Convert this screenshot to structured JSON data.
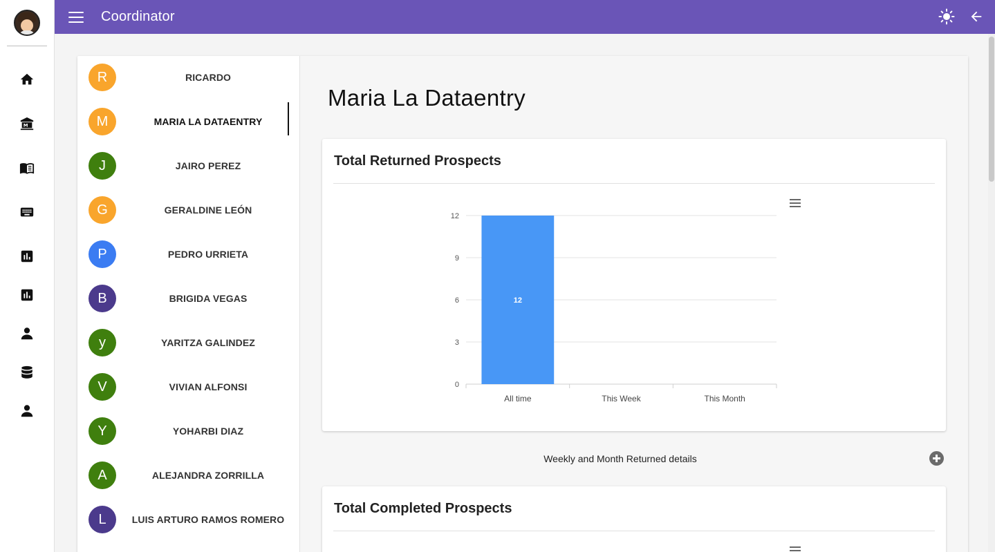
{
  "app": {
    "title": "Coordinator"
  },
  "topbar": {
    "menu_icon": "menu-icon",
    "theme_icon": "brightness-icon",
    "back_icon": "arrow-back-icon"
  },
  "rail": {
    "avatar": "user-avatar",
    "items": [
      {
        "name": "home-icon"
      },
      {
        "name": "institution-icon"
      },
      {
        "name": "book-icon"
      },
      {
        "name": "keyboard-icon"
      },
      {
        "name": "bar-chart-icon"
      },
      {
        "name": "bar-chart-icon"
      },
      {
        "name": "person-icon"
      },
      {
        "name": "database-icon"
      },
      {
        "name": "person-icon"
      }
    ]
  },
  "people": [
    {
      "initial": "R",
      "name": "RICARDO",
      "color": "#f9a52c"
    },
    {
      "initial": "M",
      "name": "MARIA LA DATAENTRY",
      "color": "#f9a52c",
      "active": true
    },
    {
      "initial": "J",
      "name": "JAIRO PEREZ",
      "color": "#3f7f0e"
    },
    {
      "initial": "G",
      "name": "GERALDINE LEÓN",
      "color": "#f9a52c"
    },
    {
      "initial": "P",
      "name": "PEDRO URRIETA",
      "color": "#3b7cf2"
    },
    {
      "initial": "B",
      "name": "BRIGIDA VEGAS",
      "color": "#4b3a8c"
    },
    {
      "initial": "y",
      "name": "YARITZA GALINDEZ",
      "color": "#3f7f0e"
    },
    {
      "initial": "V",
      "name": "VIVIAN ALFONSI",
      "color": "#3f7f0e"
    },
    {
      "initial": "Y",
      "name": "YOHARBI DIAZ",
      "color": "#3f7f0e"
    },
    {
      "initial": "A",
      "name": "ALEJANDRA ZORRILLA",
      "color": "#3f7f0e"
    },
    {
      "initial": "L",
      "name": "LUIS ARTURO RAMOS ROMERO",
      "color": "#4b3a8c"
    }
  ],
  "detail": {
    "title": "Maria La Dataentry",
    "details_label": "Weekly and Month Returned details",
    "second_panel_title": "Total Completed Prospects"
  },
  "chart_data": {
    "type": "bar",
    "title": "Total Returned Prospects",
    "categories": [
      "All time",
      "This Week",
      "This Month"
    ],
    "values": [
      12,
      0,
      0
    ],
    "data_labels": [
      "12",
      "",
      ""
    ],
    "yticks": [
      "0",
      "3",
      "6",
      "9",
      "12"
    ],
    "ylim": [
      0,
      12
    ],
    "xlabel": "",
    "ylabel": "",
    "grid": true,
    "bar_color": "#4897f6"
  }
}
